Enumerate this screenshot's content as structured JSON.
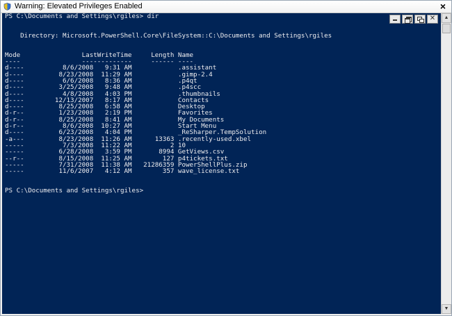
{
  "window": {
    "title": "Warning: Elevated Privileges Enabled",
    "close_glyph": "×"
  },
  "icons": {
    "title_icon": "powershell-shield-icon",
    "minimize": "minimize-icon",
    "restore": "restore-icon",
    "tile": "tile-windows-icon",
    "close": "close-icon",
    "scroll_up": "▲",
    "scroll_down": "▼"
  },
  "colors": {
    "console_background": "#012456",
    "console_text": "#eeedf0"
  },
  "console": {
    "lines": [
      "PS C:\\Documents and Settings\\rgiles> dir",
      "",
      "",
      "    Directory: Microsoft.PowerShell.Core\\FileSystem::C:\\Documents and Settings\\rgiles",
      "",
      "",
      "Mode                LastWriteTime     Length Name",
      "----                -------------     ------ ----",
      "d----          8/6/2008   9:31 AM            .assistant",
      "d----         8/23/2008  11:29 AM            .gimp-2.4",
      "d----          6/6/2008   8:36 AM            .p4qt",
      "d----         3/25/2008   9:48 AM            .p4scc",
      "d----          4/8/2008   4:03 PM            .thumbnails",
      "d----        12/13/2007   8:17 AM            Contacts",
      "d----         8/25/2008   6:58 AM            Desktop",
      "d-r--         1/23/2008   2:19 PM            Favorites",
      "d-r--         8/25/2008   8:41 AM            My Documents",
      "d-r--          8/6/2008  10:27 AM            Start Menu",
      "d----         6/23/2008   4:04 PM            _ReSharper.TempSolution",
      "-a---         8/23/2008  11:26 AM      13363 .recently-used.xbel",
      "-----          7/3/2008  11:22 AM          2 10",
      "-----         6/28/2008   3:59 PM       8994 GetViews.csv",
      "--r--         8/15/2008  11:25 AM        127 p4tickets.txt",
      "-----         7/31/2008  11:38 AM   21286359 PowerShellPlus.zip",
      "-----         11/6/2007   4:12 AM        357 wave_license.txt",
      "",
      "",
      "PS C:\\Documents and Settings\\rgiles>"
    ]
  }
}
